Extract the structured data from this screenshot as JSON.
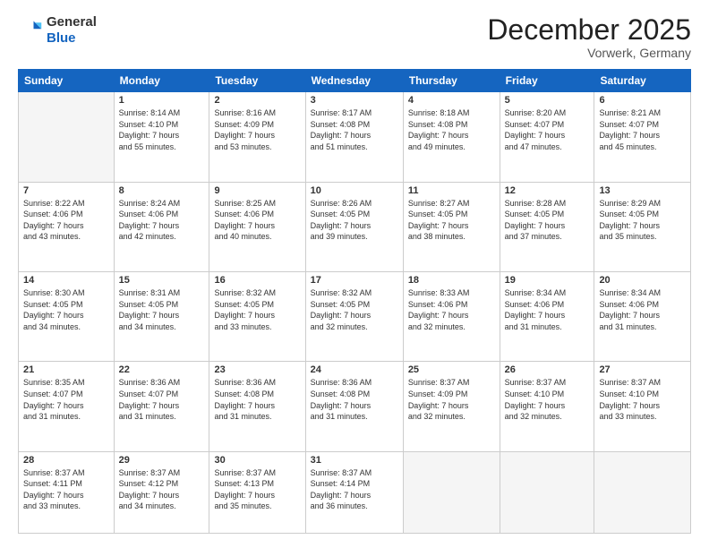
{
  "header": {
    "logo_general": "General",
    "logo_blue": "Blue",
    "month_title": "December 2025",
    "location": "Vorwerk, Germany"
  },
  "days_of_week": [
    "Sunday",
    "Monday",
    "Tuesday",
    "Wednesday",
    "Thursday",
    "Friday",
    "Saturday"
  ],
  "weeks": [
    [
      {
        "day": "",
        "info": ""
      },
      {
        "day": "1",
        "info": "Sunrise: 8:14 AM\nSunset: 4:10 PM\nDaylight: 7 hours\nand 55 minutes."
      },
      {
        "day": "2",
        "info": "Sunrise: 8:16 AM\nSunset: 4:09 PM\nDaylight: 7 hours\nand 53 minutes."
      },
      {
        "day": "3",
        "info": "Sunrise: 8:17 AM\nSunset: 4:08 PM\nDaylight: 7 hours\nand 51 minutes."
      },
      {
        "day": "4",
        "info": "Sunrise: 8:18 AM\nSunset: 4:08 PM\nDaylight: 7 hours\nand 49 minutes."
      },
      {
        "day": "5",
        "info": "Sunrise: 8:20 AM\nSunset: 4:07 PM\nDaylight: 7 hours\nand 47 minutes."
      },
      {
        "day": "6",
        "info": "Sunrise: 8:21 AM\nSunset: 4:07 PM\nDaylight: 7 hours\nand 45 minutes."
      }
    ],
    [
      {
        "day": "7",
        "info": "Sunrise: 8:22 AM\nSunset: 4:06 PM\nDaylight: 7 hours\nand 43 minutes."
      },
      {
        "day": "8",
        "info": "Sunrise: 8:24 AM\nSunset: 4:06 PM\nDaylight: 7 hours\nand 42 minutes."
      },
      {
        "day": "9",
        "info": "Sunrise: 8:25 AM\nSunset: 4:06 PM\nDaylight: 7 hours\nand 40 minutes."
      },
      {
        "day": "10",
        "info": "Sunrise: 8:26 AM\nSunset: 4:05 PM\nDaylight: 7 hours\nand 39 minutes."
      },
      {
        "day": "11",
        "info": "Sunrise: 8:27 AM\nSunset: 4:05 PM\nDaylight: 7 hours\nand 38 minutes."
      },
      {
        "day": "12",
        "info": "Sunrise: 8:28 AM\nSunset: 4:05 PM\nDaylight: 7 hours\nand 37 minutes."
      },
      {
        "day": "13",
        "info": "Sunrise: 8:29 AM\nSunset: 4:05 PM\nDaylight: 7 hours\nand 35 minutes."
      }
    ],
    [
      {
        "day": "14",
        "info": "Sunrise: 8:30 AM\nSunset: 4:05 PM\nDaylight: 7 hours\nand 34 minutes."
      },
      {
        "day": "15",
        "info": "Sunrise: 8:31 AM\nSunset: 4:05 PM\nDaylight: 7 hours\nand 34 minutes."
      },
      {
        "day": "16",
        "info": "Sunrise: 8:32 AM\nSunset: 4:05 PM\nDaylight: 7 hours\nand 33 minutes."
      },
      {
        "day": "17",
        "info": "Sunrise: 8:32 AM\nSunset: 4:05 PM\nDaylight: 7 hours\nand 32 minutes."
      },
      {
        "day": "18",
        "info": "Sunrise: 8:33 AM\nSunset: 4:06 PM\nDaylight: 7 hours\nand 32 minutes."
      },
      {
        "day": "19",
        "info": "Sunrise: 8:34 AM\nSunset: 4:06 PM\nDaylight: 7 hours\nand 31 minutes."
      },
      {
        "day": "20",
        "info": "Sunrise: 8:34 AM\nSunset: 4:06 PM\nDaylight: 7 hours\nand 31 minutes."
      }
    ],
    [
      {
        "day": "21",
        "info": "Sunrise: 8:35 AM\nSunset: 4:07 PM\nDaylight: 7 hours\nand 31 minutes."
      },
      {
        "day": "22",
        "info": "Sunrise: 8:36 AM\nSunset: 4:07 PM\nDaylight: 7 hours\nand 31 minutes."
      },
      {
        "day": "23",
        "info": "Sunrise: 8:36 AM\nSunset: 4:08 PM\nDaylight: 7 hours\nand 31 minutes."
      },
      {
        "day": "24",
        "info": "Sunrise: 8:36 AM\nSunset: 4:08 PM\nDaylight: 7 hours\nand 31 minutes."
      },
      {
        "day": "25",
        "info": "Sunrise: 8:37 AM\nSunset: 4:09 PM\nDaylight: 7 hours\nand 32 minutes."
      },
      {
        "day": "26",
        "info": "Sunrise: 8:37 AM\nSunset: 4:10 PM\nDaylight: 7 hours\nand 32 minutes."
      },
      {
        "day": "27",
        "info": "Sunrise: 8:37 AM\nSunset: 4:10 PM\nDaylight: 7 hours\nand 33 minutes."
      }
    ],
    [
      {
        "day": "28",
        "info": "Sunrise: 8:37 AM\nSunset: 4:11 PM\nDaylight: 7 hours\nand 33 minutes."
      },
      {
        "day": "29",
        "info": "Sunrise: 8:37 AM\nSunset: 4:12 PM\nDaylight: 7 hours\nand 34 minutes."
      },
      {
        "day": "30",
        "info": "Sunrise: 8:37 AM\nSunset: 4:13 PM\nDaylight: 7 hours\nand 35 minutes."
      },
      {
        "day": "31",
        "info": "Sunrise: 8:37 AM\nSunset: 4:14 PM\nDaylight: 7 hours\nand 36 minutes."
      },
      {
        "day": "",
        "info": ""
      },
      {
        "day": "",
        "info": ""
      },
      {
        "day": "",
        "info": ""
      }
    ]
  ]
}
